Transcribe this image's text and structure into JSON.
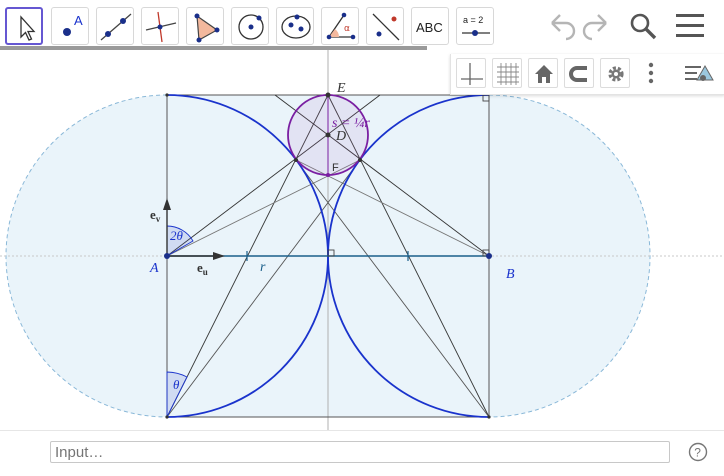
{
  "toolbar": {
    "tools": [
      {
        "icon": "move-arrow-icon"
      },
      {
        "icon": "point-icon",
        "label": "A"
      },
      {
        "icon": "line-icon"
      },
      {
        "icon": "perpendicular-line-icon"
      },
      {
        "icon": "polygon-icon"
      },
      {
        "icon": "circle-center-point-icon"
      },
      {
        "icon": "ellipse-icon"
      },
      {
        "icon": "angle-icon"
      },
      {
        "icon": "reflect-icon"
      },
      {
        "icon": "text-icon",
        "label": "ABC"
      },
      {
        "icon": "slider-icon",
        "label": "a = 2"
      }
    ],
    "progress": 0.59
  },
  "stylebar": {
    "buttons": [
      "axes-icon",
      "grid-icon",
      "home-icon",
      "snap-magnet-icon",
      "settings-gear-icon",
      "more-dots-icon",
      "toggle-stylebar-icon"
    ]
  },
  "canvas": {
    "points": {
      "A": "A",
      "B": "B",
      "D": "D",
      "E": "E",
      "F": "F"
    },
    "labels": {
      "ev": "e",
      "ev_sub": "v",
      "eu": "e",
      "eu_sub": "u",
      "two_theta": "2θ",
      "theta": "θ",
      "r": "r",
      "s_eq": "s = ¼r"
    },
    "colors": {
      "arc": "#1a33cc",
      "small_circle": "#7a1fa2",
      "fill": "#eaf4fa",
      "segment_ab": "#1a5f8a",
      "construction": "#333333",
      "axis": "#b0b0b0"
    }
  },
  "input": {
    "placeholder": "Input…"
  },
  "help_label": "?"
}
